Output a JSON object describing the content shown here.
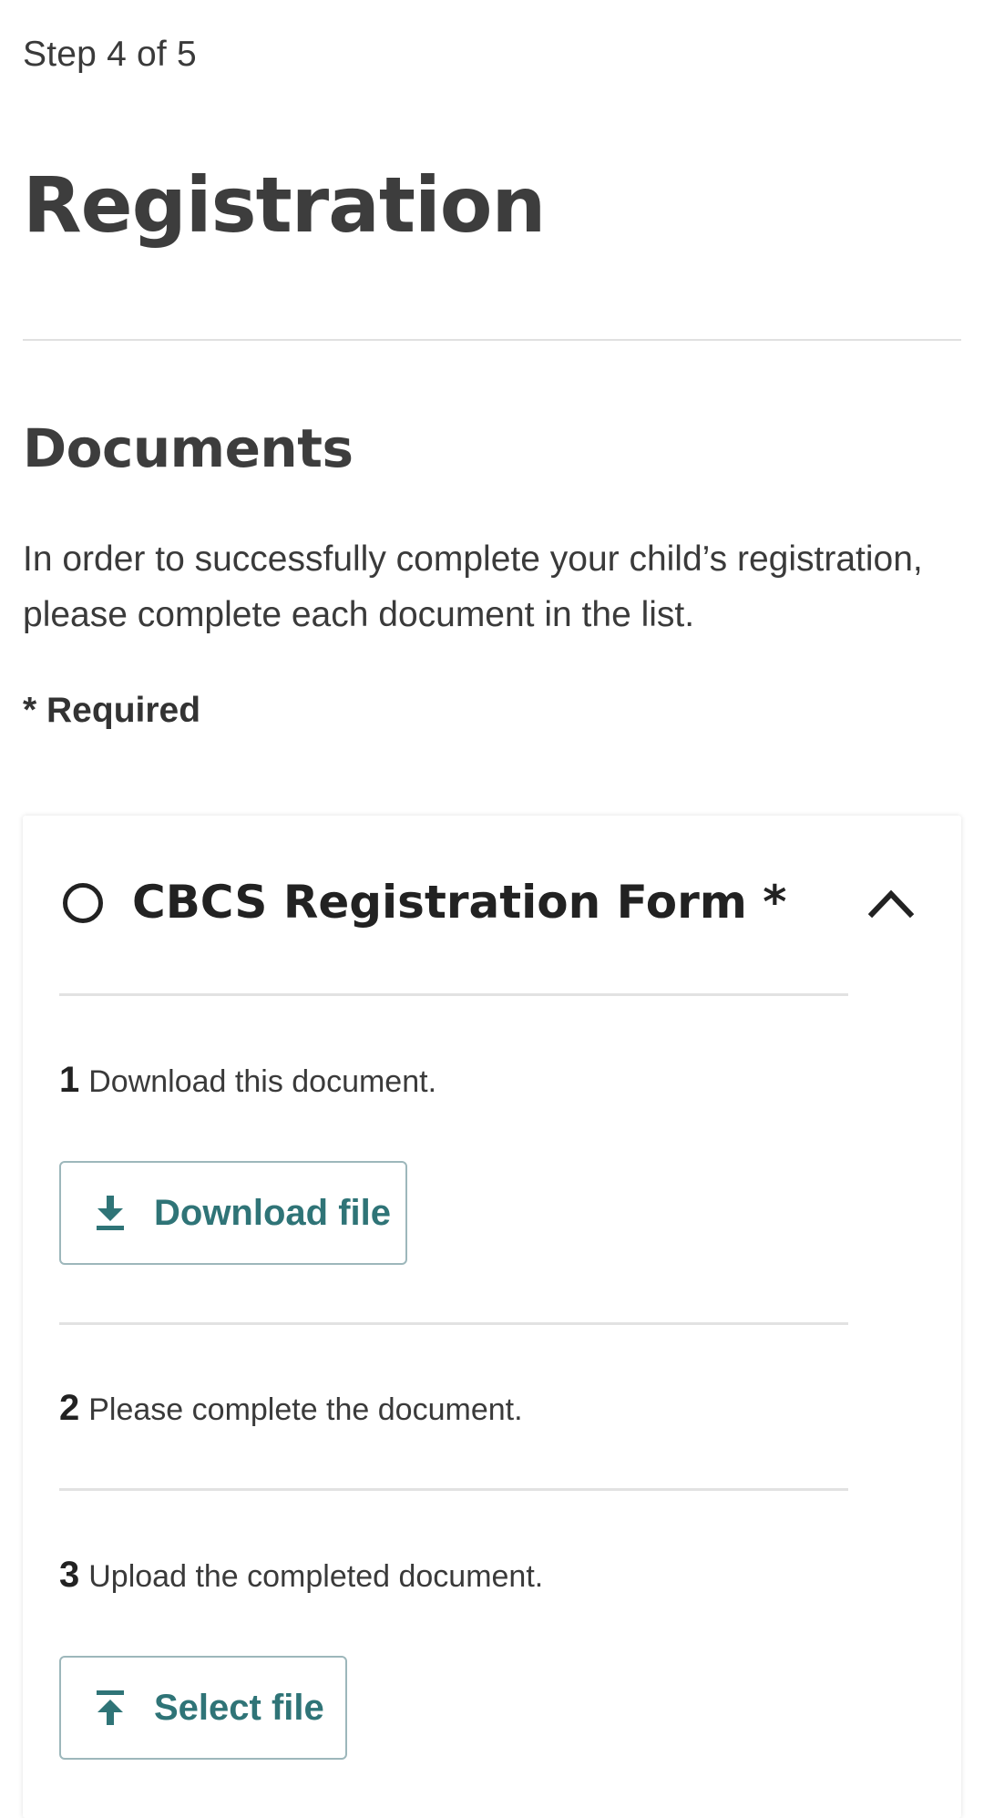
{
  "header": {
    "step": "Step 4 of 5",
    "title": "Registration"
  },
  "section": {
    "title": "Documents",
    "intro_line1": "In order to successfully complete your child’s registration,",
    "intro_line2": "please complete each document in the list.",
    "required_note": "* Required"
  },
  "document": {
    "title": "CBCS Registration Form *",
    "status": "incomplete",
    "expanded": true,
    "steps": [
      {
        "number": "1",
        "text": "Download this document."
      },
      {
        "number": "2",
        "text": "Please complete the document."
      },
      {
        "number": "3",
        "text": "Upload the completed document."
      }
    ],
    "download_label": "Download file",
    "select_label": "Select file"
  },
  "icons": {
    "status": "empty-circle-icon",
    "toggle": "chevron-up-icon",
    "download": "download-icon",
    "upload": "upload-icon"
  },
  "colors": {
    "text": "#333333",
    "accent": "#2f7477",
    "button_border": "#9db7bb",
    "divider": "#e2e2e2"
  }
}
